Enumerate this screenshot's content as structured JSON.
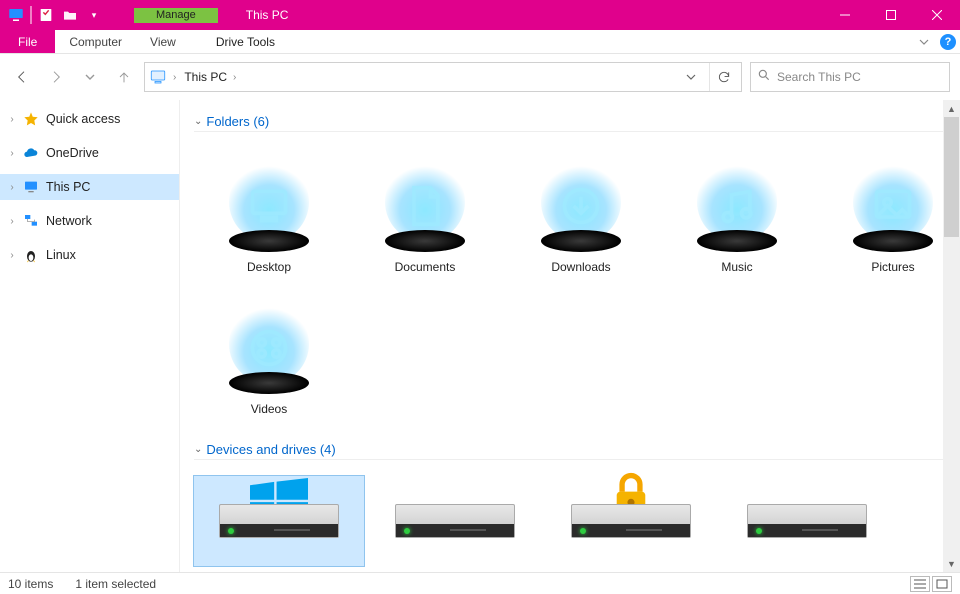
{
  "window": {
    "title": "This PC",
    "context_tab_group": "Manage",
    "context_tab": "Drive Tools"
  },
  "ribbon": {
    "file": "File",
    "tabs": [
      "Computer",
      "View"
    ]
  },
  "breadcrumb": {
    "location": "This PC"
  },
  "search": {
    "placeholder": "Search This PC"
  },
  "nav": {
    "items": [
      {
        "label": "Quick access",
        "icon": "star",
        "expandable": true
      },
      {
        "label": "OneDrive",
        "icon": "cloud",
        "expandable": true
      },
      {
        "label": "This PC",
        "icon": "monitor",
        "expandable": true,
        "selected": true
      },
      {
        "label": "Network",
        "icon": "network",
        "expandable": true
      },
      {
        "label": "Linux",
        "icon": "penguin",
        "expandable": true
      }
    ]
  },
  "sections": {
    "folders": {
      "header": "Folders (6)",
      "items": [
        "Desktop",
        "Documents",
        "Downloads",
        "Music",
        "Pictures",
        "Videos"
      ]
    },
    "drives": {
      "header": "Devices and drives (4)",
      "count": 4
    }
  },
  "drives": [
    {
      "os": true,
      "locked": false,
      "selected": true
    },
    {
      "os": false,
      "locked": false,
      "selected": false
    },
    {
      "os": false,
      "locked": true,
      "selected": false
    },
    {
      "os": false,
      "locked": false,
      "selected": false
    }
  ],
  "status": {
    "items": "10 items",
    "selection": "1 item selected"
  },
  "colors": {
    "accent": "#e0018c",
    "context_green": "#7cc242",
    "selection": "#cde8ff",
    "link": "#0066cc"
  }
}
